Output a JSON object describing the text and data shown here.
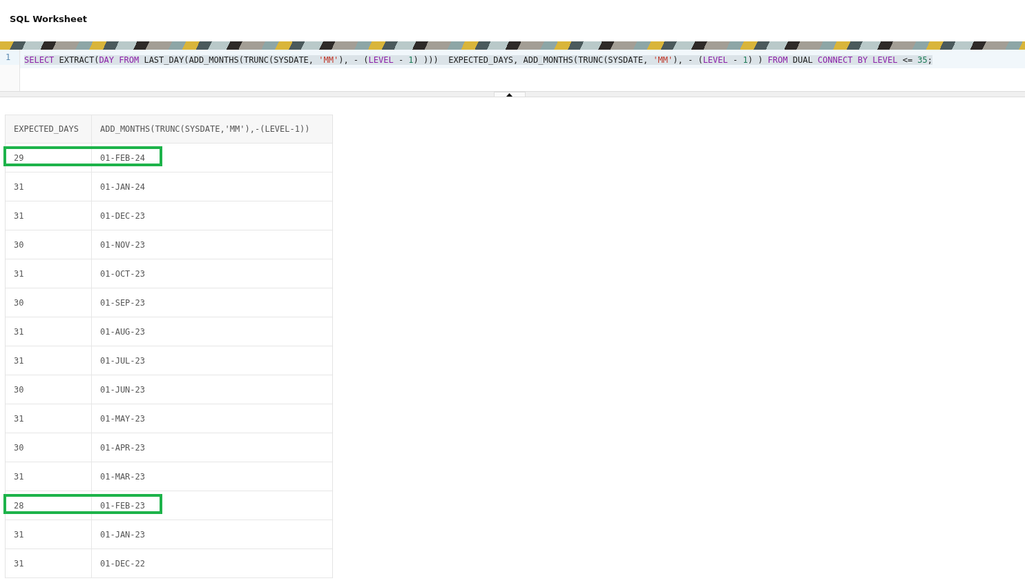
{
  "title": "SQL Worksheet",
  "editor": {
    "line_number": "1",
    "tokens": [
      {
        "kind": "keyword",
        "text": "SELECT"
      },
      {
        "kind": "plain",
        "text": " EXTRACT("
      },
      {
        "kind": "keyword",
        "text": "DAY FROM"
      },
      {
        "kind": "plain",
        "text": " LAST_DAY(ADD_MONTHS(TRUNC(SYSDATE, "
      },
      {
        "kind": "string",
        "text": "'MM'"
      },
      {
        "kind": "plain",
        "text": "), - ("
      },
      {
        "kind": "keyword",
        "text": "LEVEL"
      },
      {
        "kind": "plain",
        "text": " - "
      },
      {
        "kind": "number",
        "text": "1"
      },
      {
        "kind": "plain",
        "text": ") )))  EXPECTED_DAYS, ADD_MONTHS(TRUNC(SYSDATE, "
      },
      {
        "kind": "string",
        "text": "'MM'"
      },
      {
        "kind": "plain",
        "text": "), - ("
      },
      {
        "kind": "keyword",
        "text": "LEVEL"
      },
      {
        "kind": "plain",
        "text": " - "
      },
      {
        "kind": "number",
        "text": "1"
      },
      {
        "kind": "plain",
        "text": ") ) "
      },
      {
        "kind": "keyword",
        "text": "FROM"
      },
      {
        "kind": "plain",
        "text": " DUAL "
      },
      {
        "kind": "keyword",
        "text": "CONNECT BY LEVEL"
      },
      {
        "kind": "plain",
        "text": " <= "
      },
      {
        "kind": "number",
        "text": "35"
      },
      {
        "kind": "plain",
        "text": ";"
      }
    ]
  },
  "table": {
    "columns": [
      "EXPECTED_DAYS",
      "ADD_MONTHS(TRUNC(SYSDATE,'MM'),-(LEVEL-1))"
    ],
    "rows": [
      {
        "cells": [
          "29",
          "01-FEB-24"
        ],
        "highlighted": true
      },
      {
        "cells": [
          "31",
          "01-JAN-24"
        ],
        "highlighted": false
      },
      {
        "cells": [
          "31",
          "01-DEC-23"
        ],
        "highlighted": false
      },
      {
        "cells": [
          "30",
          "01-NOV-23"
        ],
        "highlighted": false
      },
      {
        "cells": [
          "31",
          "01-OCT-23"
        ],
        "highlighted": false
      },
      {
        "cells": [
          "30",
          "01-SEP-23"
        ],
        "highlighted": false
      },
      {
        "cells": [
          "31",
          "01-AUG-23"
        ],
        "highlighted": false
      },
      {
        "cells": [
          "31",
          "01-JUL-23"
        ],
        "highlighted": false
      },
      {
        "cells": [
          "30",
          "01-JUN-23"
        ],
        "highlighted": false
      },
      {
        "cells": [
          "31",
          "01-MAY-23"
        ],
        "highlighted": false
      },
      {
        "cells": [
          "30",
          "01-APR-23"
        ],
        "highlighted": false
      },
      {
        "cells": [
          "31",
          "01-MAR-23"
        ],
        "highlighted": false
      },
      {
        "cells": [
          "28",
          "01-FEB-23"
        ],
        "highlighted": true
      },
      {
        "cells": [
          "31",
          "01-JAN-23"
        ],
        "highlighted": false
      },
      {
        "cells": [
          "31",
          "01-DEC-22"
        ],
        "highlighted": false
      }
    ]
  }
}
